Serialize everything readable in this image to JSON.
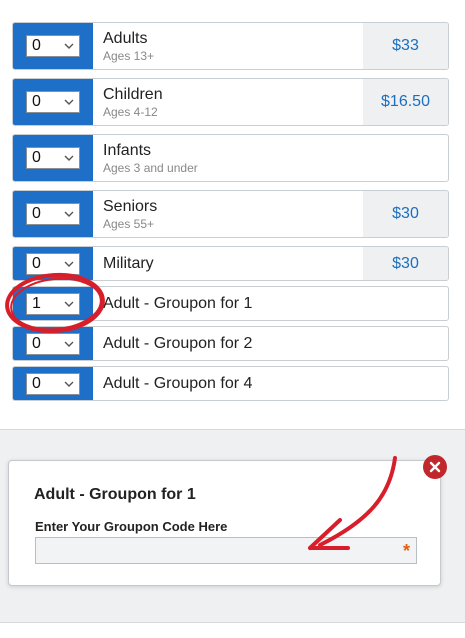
{
  "tickets": [
    {
      "qty": "0",
      "name": "Adults",
      "sub": "Ages 13+",
      "price": "$33"
    },
    {
      "qty": "0",
      "name": "Children",
      "sub": "Ages 4-12",
      "price": "$16.50"
    },
    {
      "qty": "0",
      "name": "Infants",
      "sub": "Ages 3 and under",
      "price": ""
    },
    {
      "qty": "0",
      "name": "Seniors",
      "sub": "Ages 55+",
      "price": "$30"
    },
    {
      "qty": "0",
      "name": "Military",
      "sub": "",
      "price": "$30"
    },
    {
      "qty": "1",
      "name": "Adult - Groupon for 1",
      "sub": "",
      "price": ""
    },
    {
      "qty": "0",
      "name": "Adult - Groupon for 2",
      "sub": "",
      "price": ""
    },
    {
      "qty": "0",
      "name": "Adult - Groupon for 4",
      "sub": "",
      "price": ""
    }
  ],
  "modal": {
    "title": "Adult - Groupon for 1",
    "field_label": "Enter Your Groupon Code Here",
    "field_value": "",
    "required_marker": "*"
  },
  "colors": {
    "accent": "#1e6fc8",
    "price_text": "#1b6fc0",
    "close": "#c0282d",
    "annotation": "#d81e2a"
  },
  "icons": {
    "dropdown": "chevron-down-icon",
    "close": "close-icon",
    "annotation_circle": "red-circle-annotation",
    "annotation_arrow": "red-arrow-annotation"
  }
}
